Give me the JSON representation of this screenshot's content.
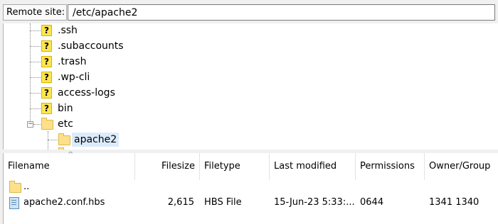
{
  "remote_site": {
    "label": "Remote site:",
    "path": "/etc/apache2"
  },
  "tree": {
    "items": [
      {
        "label": ".ssh",
        "icon": "unknown-folder"
      },
      {
        "label": ".subaccounts",
        "icon": "unknown-folder"
      },
      {
        "label": ".trash",
        "icon": "unknown-folder"
      },
      {
        "label": ".wp-cli",
        "icon": "unknown-folder"
      },
      {
        "label": "access-logs",
        "icon": "unknown-folder"
      },
      {
        "label": "bin",
        "icon": "unknown-folder"
      },
      {
        "label": "etc",
        "icon": "folder",
        "expanded": true
      },
      {
        "label": "apache2",
        "icon": "folder",
        "selected": true
      }
    ]
  },
  "file_list": {
    "columns": [
      "Filename",
      "Filesize",
      "Filetype",
      "Last modified",
      "Permissions",
      "Owner/Group"
    ],
    "rows": [
      {
        "filename": "..",
        "icon": "folder",
        "filesize": "",
        "filetype": "",
        "modified": "",
        "permissions": "",
        "owner": ""
      },
      {
        "filename": "apache2.conf.hbs",
        "icon": "file",
        "filesize": "2,615",
        "filetype": "HBS File",
        "modified": "15-Jun-23 5:33:...",
        "permissions": "0644",
        "owner": "1341 1340"
      }
    ]
  },
  "colors": {
    "selection": "#dcebfc",
    "folder": "#ffe08a",
    "unknown": "#ffe54f"
  }
}
